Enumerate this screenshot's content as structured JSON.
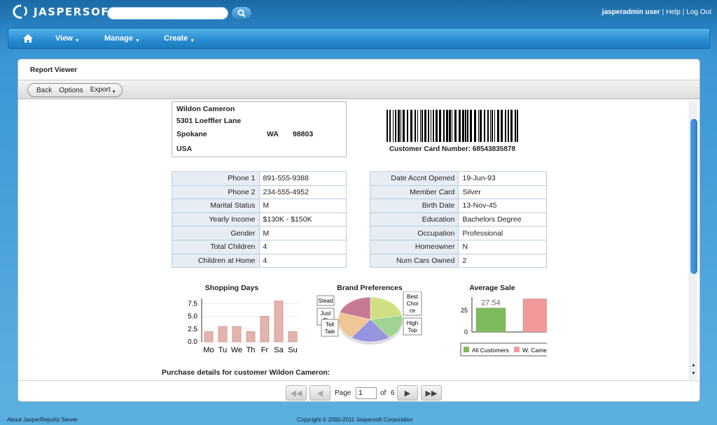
{
  "header": {
    "logo_text": "JASPERSOFT",
    "search": {
      "value": "",
      "placeholder": ""
    },
    "user": "jasperadmin user",
    "help": "Help",
    "logout": "Log Out",
    "separator": "|"
  },
  "nav": {
    "home_icon": "home-icon",
    "items": [
      {
        "label": "View"
      },
      {
        "label": "Manage"
      },
      {
        "label": "Create"
      }
    ]
  },
  "panel": {
    "title": "Report Viewer",
    "toolbar": {
      "back": "Back",
      "options": "Options",
      "export": "Export"
    }
  },
  "report": {
    "address": {
      "name": "Wildon Cameron",
      "street": "5301 Loeffler Lane",
      "city": "Spokane",
      "state": "WA",
      "zip": "98803",
      "country": "USA"
    },
    "card_number_label": "Customer Card Number: 68543835878",
    "left_table": [
      {
        "k": "Phone 1",
        "v": "891-555-9388"
      },
      {
        "k": "Phone 2",
        "v": "234-555-4952"
      },
      {
        "k": "Marital Status",
        "v": "M"
      },
      {
        "k": "Yearly Income",
        "v": "$130K - $150K"
      },
      {
        "k": "Gender",
        "v": "M"
      },
      {
        "k": "Total Children",
        "v": "4"
      },
      {
        "k": "Children at Home",
        "v": "4"
      }
    ],
    "right_table": [
      {
        "k": "Date Accnt Opened",
        "v": "19-Jun-93"
      },
      {
        "k": "Member Card",
        "v": "Silver"
      },
      {
        "k": "Birth Date",
        "v": "13-Nov-45"
      },
      {
        "k": "Education",
        "v": "Bachelors Degree"
      },
      {
        "k": "Occupation",
        "v": "Professional"
      },
      {
        "k": "Homeowner",
        "v": "N"
      },
      {
        "k": "Num Cars Owned",
        "v": "2"
      }
    ],
    "purchase_title": "Purchase details for customer Wildon Cameron:"
  },
  "charts": {
    "shopping_days": {
      "title": "Shopping Days",
      "categories": [
        "Mo",
        "Tu",
        "We",
        "Th",
        "Fr",
        "Sa",
        "Su"
      ],
      "values": [
        2,
        3,
        3,
        2,
        5,
        8,
        2
      ],
      "ylim": [
        0,
        8.5
      ],
      "yticks": [
        "7.5",
        "5.0",
        "2.5",
        "0.0"
      ],
      "bar_color": "#e3b3ad"
    },
    "brand_preferences": {
      "title": "Brand Preferences",
      "labels": [
        "Stead",
        "Just",
        "Tell Tale",
        "Best Choice",
        "High Top"
      ],
      "label_lines": [
        [
          "Stead",
          ""
        ],
        [
          "Just",
          "Ri"
        ],
        [
          "Tell",
          "Tale"
        ],
        [
          "Best",
          "Choi",
          "ce"
        ],
        [
          "High",
          "Top"
        ]
      ],
      "colors": [
        "#cfe07a",
        "#9bd38c",
        "#8f8de0",
        "#f4c48e",
        "#c46f8e"
      ]
    },
    "average_sale": {
      "title": "Average Sale",
      "series": [
        {
          "name": "All Customers",
          "value": 27.54,
          "color": "#7dbb5c"
        },
        {
          "name": "W. Cameron",
          "value": 38,
          "color": "#f2999a"
        }
      ],
      "data_label": "27.54",
      "yticks": [
        "25",
        "0"
      ]
    }
  },
  "pager": {
    "page_label": "Page",
    "current": "1",
    "of_label": "of",
    "total": "6"
  },
  "footer": {
    "about": "About JasperReports Server",
    "copyright": "Copyright © 2000-2011 Jaspersoft Corporation"
  }
}
